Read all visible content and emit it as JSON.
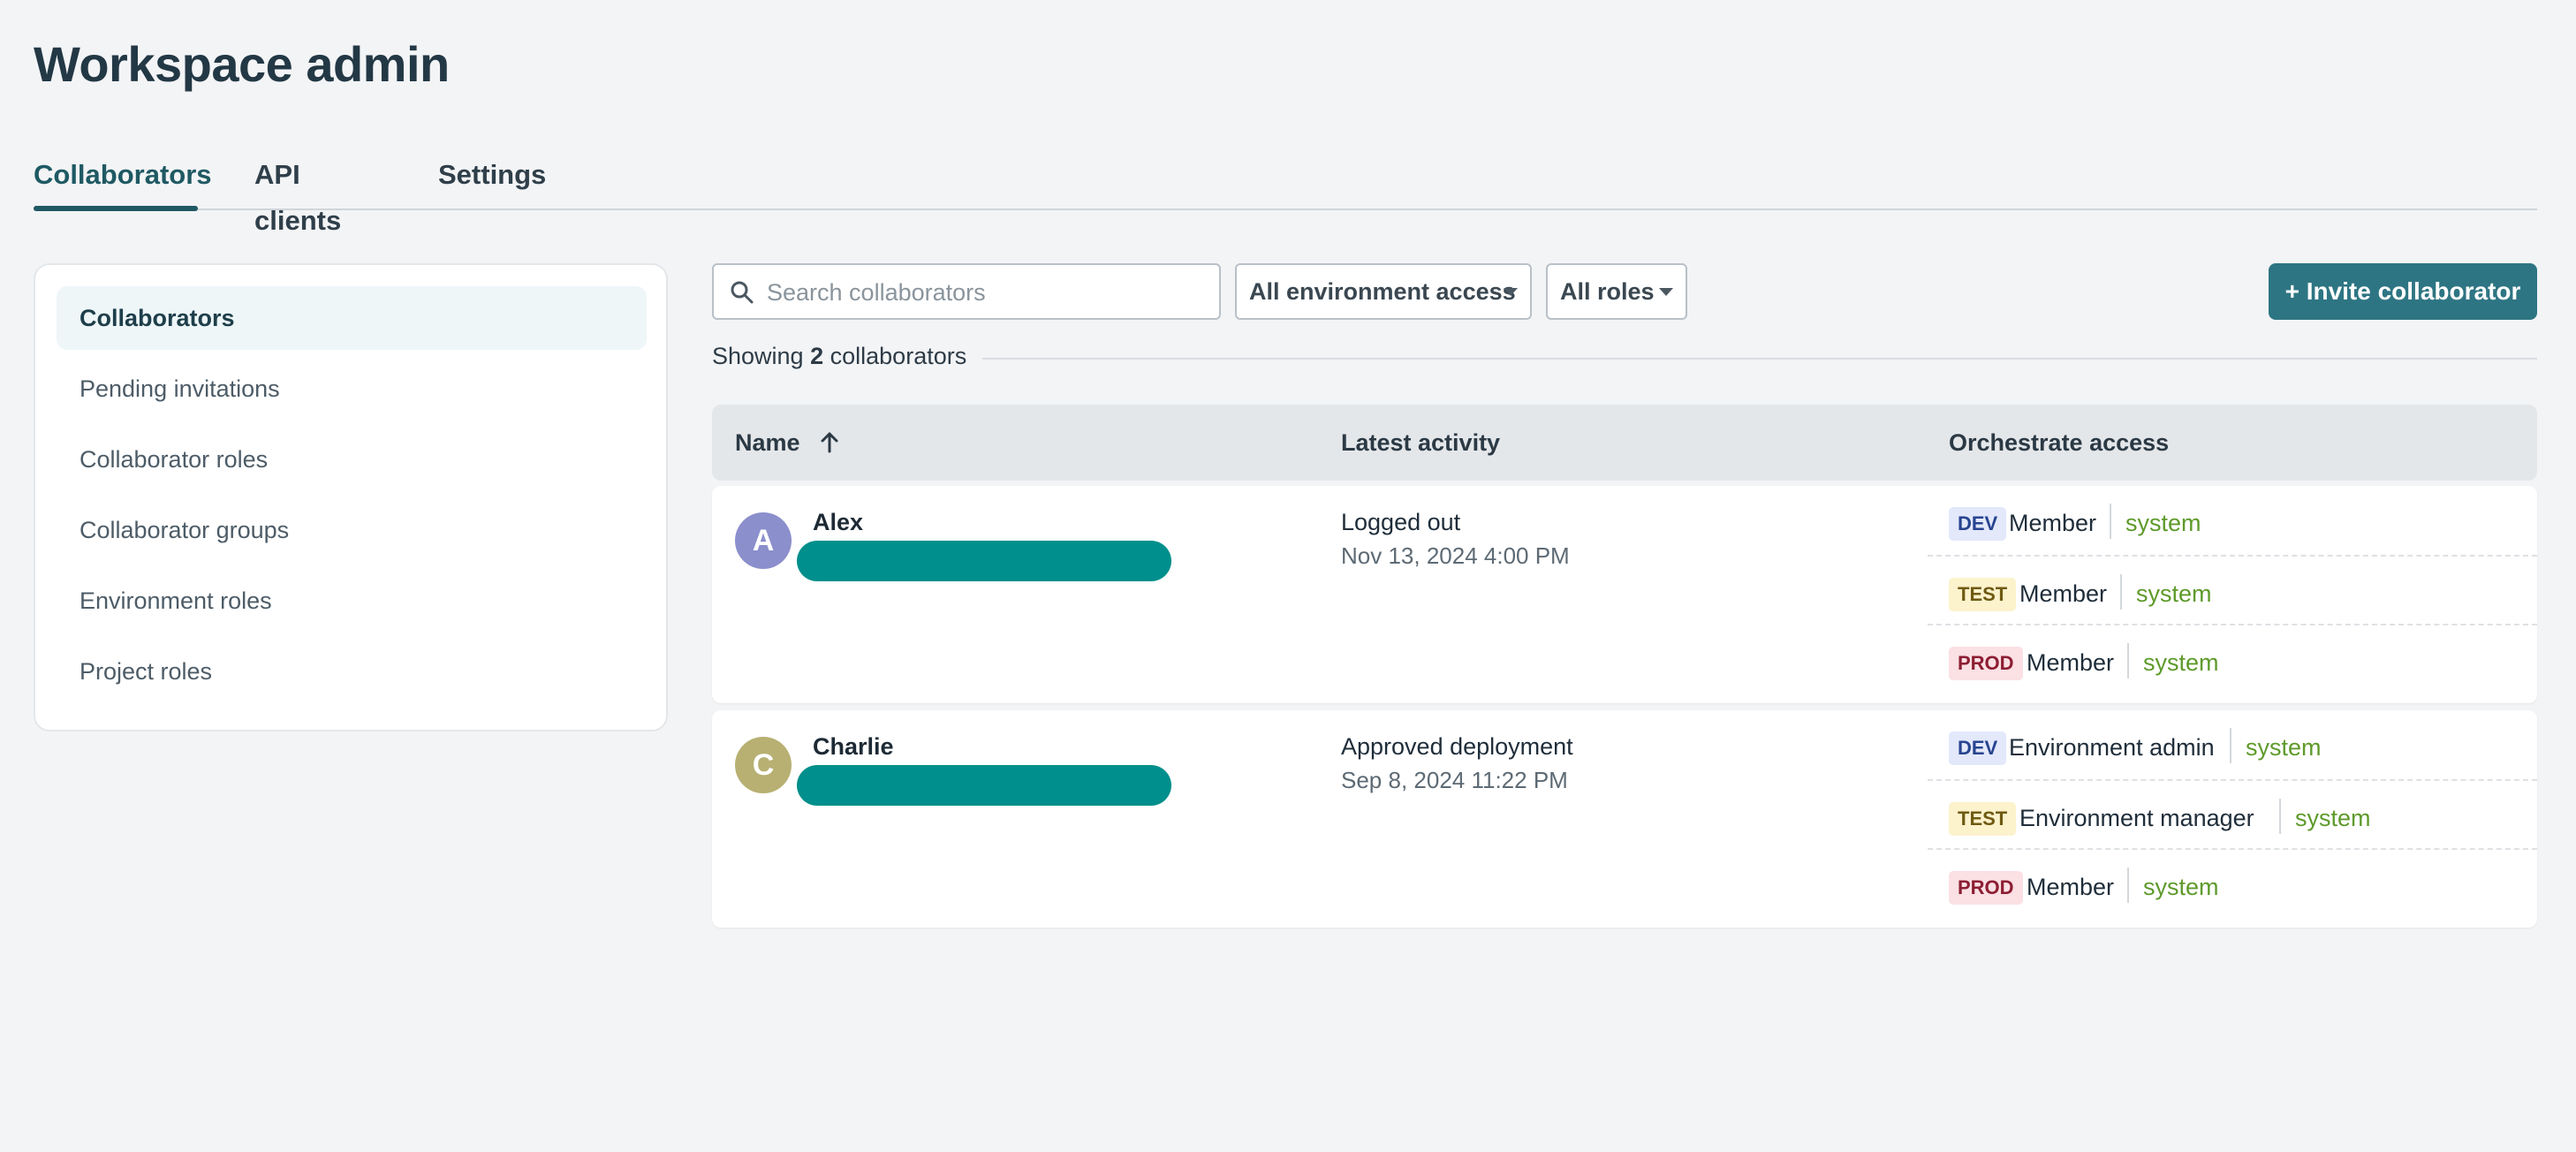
{
  "page": {
    "title": "Workspace admin"
  },
  "tabs": [
    {
      "label": "Collaborators",
      "active": true
    },
    {
      "label": "API clients",
      "active": false
    },
    {
      "label": "Settings",
      "active": false
    }
  ],
  "sidebar": {
    "items": [
      {
        "label": "Collaborators",
        "active": true
      },
      {
        "label": "Pending invitations",
        "active": false
      },
      {
        "label": "Collaborator roles",
        "active": false
      },
      {
        "label": "Collaborator groups",
        "active": false
      },
      {
        "label": "Environment roles",
        "active": false
      },
      {
        "label": "Project roles",
        "active": false
      }
    ]
  },
  "toolbar": {
    "search_placeholder": "Search collaborators",
    "env_filter": "All environment access",
    "role_filter": "All roles",
    "invite_label": "+ Invite collaborator"
  },
  "summary": {
    "prefix": "Showing",
    "count": "2",
    "suffix": "collaborators"
  },
  "table": {
    "headers": {
      "name": "Name",
      "activity": "Latest activity",
      "access": "Orchestrate access"
    },
    "rows": [
      {
        "initial": "A",
        "avatar_color": "#8b8fcc",
        "name": "Alex",
        "activity": "Logged out",
        "activity_time": "Nov 13, 2024 4:00 PM",
        "access": [
          {
            "env": "DEV",
            "role": "Member",
            "source": "system"
          },
          {
            "env": "TEST",
            "role": "Member",
            "source": "system"
          },
          {
            "env": "PROD",
            "role": "Member",
            "source": "system"
          }
        ]
      },
      {
        "initial": "C",
        "avatar_color": "#b7b072",
        "name": "Charlie",
        "activity": "Approved deployment",
        "activity_time": "Sep 8, 2024 11:22 PM",
        "access": [
          {
            "env": "DEV",
            "role": "Environment admin",
            "source": "system"
          },
          {
            "env": "TEST",
            "role": "Environment manager",
            "source": "system"
          },
          {
            "env": "PROD",
            "role": "Member",
            "source": "system"
          }
        ]
      }
    ]
  },
  "colors": {
    "accent": "#2e7583",
    "active_tab": "#1f5963",
    "redaction": "#008f8c",
    "source_text": "#5e9a2b"
  },
  "icons": {
    "search": "search-icon",
    "sort": "arrow-up-icon",
    "caret": "chevron-down-icon"
  }
}
